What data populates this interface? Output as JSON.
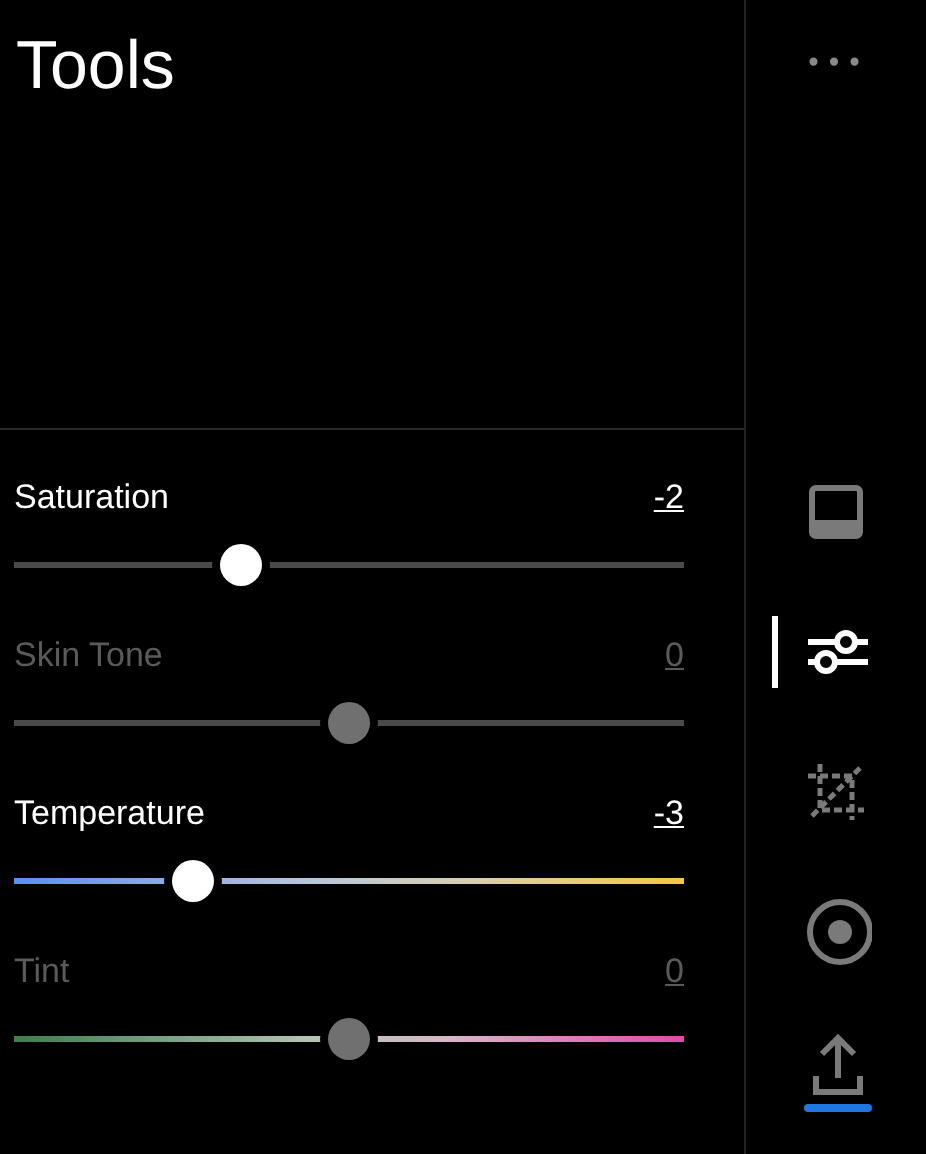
{
  "panel": {
    "title": "Tools"
  },
  "sliders": [
    {
      "label": "Saturation",
      "value": "-2",
      "kind": "plain",
      "disabled": false,
      "level": 0.34
    },
    {
      "label": "Skin Tone",
      "value": "0",
      "kind": "plain",
      "disabled": true,
      "level": 0.5
    },
    {
      "label": "Temperature",
      "value": "-3",
      "kind": "temperature",
      "disabled": false,
      "level": 0.27
    },
    {
      "label": "Tint",
      "value": "0",
      "kind": "tint",
      "disabled": true,
      "level": 0.5
    }
  ],
  "rail": {
    "more": "•••",
    "tools": [
      {
        "kind": "frame",
        "selected": false
      },
      {
        "kind": "adjust",
        "selected": true
      },
      {
        "kind": "crop",
        "selected": false
      },
      {
        "kind": "effect",
        "selected": false
      },
      {
        "kind": "share",
        "selected": false
      }
    ]
  }
}
